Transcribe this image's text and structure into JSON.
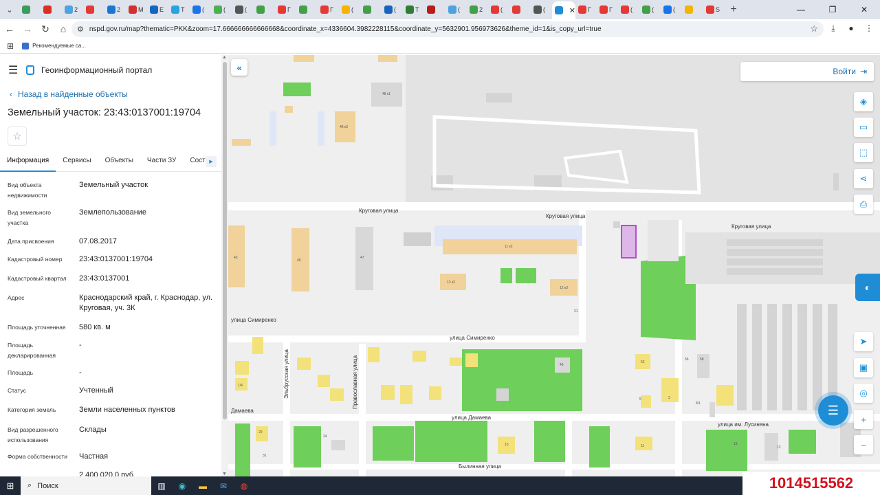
{
  "browser": {
    "tabs": [
      {
        "color": "#3a9d5d",
        "title": ""
      },
      {
        "color": "#d93025",
        "title": ""
      },
      {
        "color": "#4da3e0",
        "title": "2"
      },
      {
        "color": "#e53935",
        "title": ""
      },
      {
        "color": "#1976d2",
        "title": "2"
      },
      {
        "color": "#d32f2f",
        "title": "М"
      },
      {
        "color": "#1565c0",
        "title": "Е"
      },
      {
        "color": "#2aa3e0",
        "title": "Т"
      },
      {
        "color": "#1a73e8",
        "title": "("
      },
      {
        "color": "#4caf50",
        "title": "("
      },
      {
        "color": "#555555",
        "title": "("
      },
      {
        "color": "#43a047",
        "title": ""
      },
      {
        "color": "#e53935",
        "title": "Г"
      },
      {
        "color": "#43a047",
        "title": ""
      },
      {
        "color": "#e53935",
        "title": "Г"
      },
      {
        "color": "#f5b400",
        "title": "("
      },
      {
        "color": "#43a047",
        "title": ""
      },
      {
        "color": "#1565c0",
        "title": "("
      },
      {
        "color": "#2e7d32",
        "title": "Т"
      },
      {
        "color": "#b71c1c",
        "title": ""
      },
      {
        "color": "#4da3e0",
        "title": "("
      },
      {
        "color": "#43a047",
        "title": "2"
      },
      {
        "color": "#e53935",
        "title": "("
      },
      {
        "color": "#e53935",
        "title": ""
      },
      {
        "color": "#555555",
        "title": "("
      }
    ],
    "active_tab": {
      "color": "#1f8dd6",
      "title": ""
    },
    "tabs_after": [
      {
        "color": "#e53935",
        "title": "Г"
      },
      {
        "color": "#e53935",
        "title": "Г"
      },
      {
        "color": "#e53935",
        "title": "("
      },
      {
        "color": "#43a047",
        "title": "("
      },
      {
        "color": "#1a73e8",
        "title": "("
      },
      {
        "color": "#f5b400",
        "title": ""
      },
      {
        "color": "#e53935",
        "title": "S"
      }
    ],
    "url": "nspd.gov.ru/map?thematic=PKK&zoom=17.666666666666668&coordinate_x=4336604.3982228115&coordinate_y=5632901.956973626&theme_id=1&is_copy_url=true",
    "bookmark_label": "Рекомендуемые са..."
  },
  "panel": {
    "portal_name": "Геоинформационный портал",
    "back_label": "Назад в найденные объекты",
    "title": "Земельный участок: 23:43:0137001:19704",
    "tabs": [
      "Информация",
      "Сервисы",
      "Объекты",
      "Части ЗУ",
      "Соста"
    ],
    "props": [
      {
        "k": "Вид объекта недвижимости",
        "v": "Земельный участок"
      },
      {
        "k": "Вид земельного участка",
        "v": "Землепользование"
      },
      {
        "k": "Дата присвоения",
        "v": "07.08.2017"
      },
      {
        "k": "Кадастровый номер",
        "v": "23:43:0137001:19704"
      },
      {
        "k": "Кадастровый квартал",
        "v": "23:43:0137001"
      },
      {
        "k": "Адрес",
        "v": "Краснодарский край, г. Краснодар, ул. Круговая, уч. 3К"
      },
      {
        "k": "Площадь уточненная",
        "v": "580 кв. м"
      },
      {
        "k": "Площадь декларированная",
        "v": "-"
      },
      {
        "k": "Площадь",
        "v": "-"
      },
      {
        "k": "Статус",
        "v": "Учтенный"
      },
      {
        "k": "Категория земель",
        "v": "Земли населенных пунктов"
      },
      {
        "k": "Вид разрешенного использования",
        "v": "Склады"
      },
      {
        "k": "Форма собственности",
        "v": "Частная"
      },
      {
        "k": "",
        "v": "2 400 020,0 руб"
      }
    ]
  },
  "map": {
    "login_label": "Войти",
    "streets": {
      "krugovaya_1": "Круговая улица",
      "krugovaya_2": "Круговая улица",
      "krugovaya_3": "Круговая улица",
      "simirenko_1": "улица Симиренко",
      "simirenko_2": "улица Симиренко",
      "damaeva_1": "Дамаева",
      "damaeva_2": "улица Дамаева",
      "lusinyana": "улица им. Лусиняна",
      "bylinnaya": "Былинная улица",
      "elbrusskaya": "Эльбрусская улица",
      "pravoslavnaya": "Православная улица"
    },
    "building_numbers": [
      "48 к1",
      "48 к3",
      "43",
      "45",
      "47",
      "11 к2",
      "12 к2",
      "12 к3",
      "1/4",
      "46",
      "52",
      "56",
      "58",
      "5",
      "3",
      "8/1",
      "29",
      "24",
      "31",
      "13",
      "15",
      "11",
      "12",
      "21"
    ],
    "colors": {
      "building": "#f0d29a",
      "building_yellow": "#f3e27a",
      "green": "#6ecf5a",
      "road": "#ffffff",
      "selected": "#b54ec9",
      "bg": "#efefef"
    }
  },
  "taskbar": {
    "search_label": "Поиск"
  },
  "overlay_number": "1014515562"
}
